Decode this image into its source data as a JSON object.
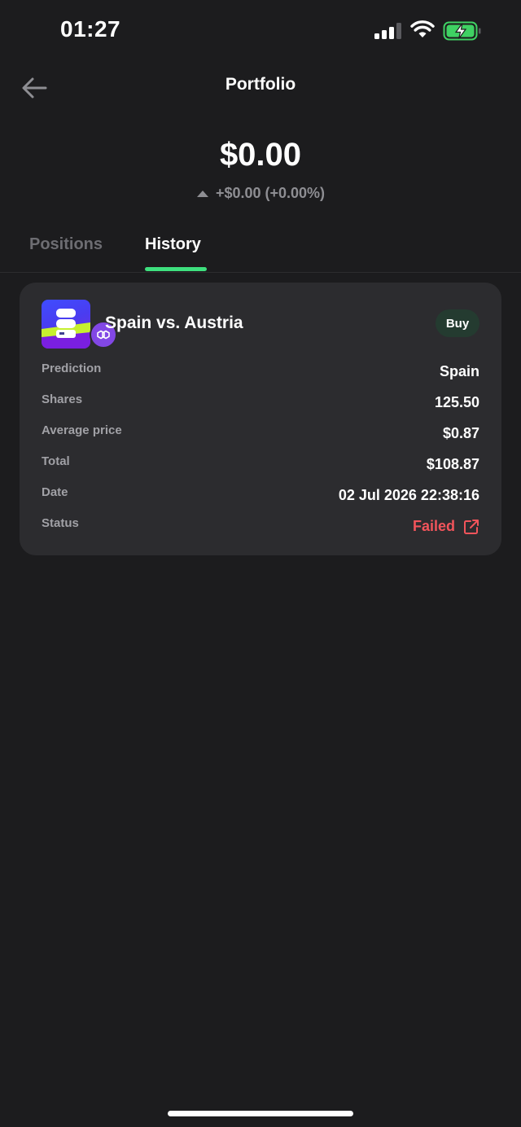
{
  "status_bar": {
    "time": "01:27"
  },
  "header": {
    "title": "Portfolio"
  },
  "summary": {
    "balance": "$0.00",
    "change": "+$0.00 (+0.00%)"
  },
  "tabs": [
    {
      "label": "Positions",
      "active": false
    },
    {
      "label": "History",
      "active": true
    }
  ],
  "history": [
    {
      "title": "Spain vs. Austria",
      "side": "Buy",
      "rows": {
        "prediction": {
          "label": "Prediction",
          "value": "Spain"
        },
        "shares": {
          "label": "Shares",
          "value": "125.50"
        },
        "average_price": {
          "label": "Average price",
          "value": "$0.87"
        },
        "total": {
          "label": "Total",
          "value": "$108.87"
        },
        "date": {
          "label": "Date",
          "value": "02 Jul 2026 22:38:16"
        },
        "status": {
          "label": "Status",
          "value": "Failed"
        }
      }
    }
  ],
  "colors": {
    "background": "#1c1c1e",
    "card": "#2c2c2f",
    "accent_green": "#3ee07e",
    "failed_red": "#f2545b"
  },
  "icons": {
    "back": "arrow-left-icon",
    "change": "triangle-up-icon",
    "status_link": "external-link-icon",
    "network": "polygon-icon"
  }
}
